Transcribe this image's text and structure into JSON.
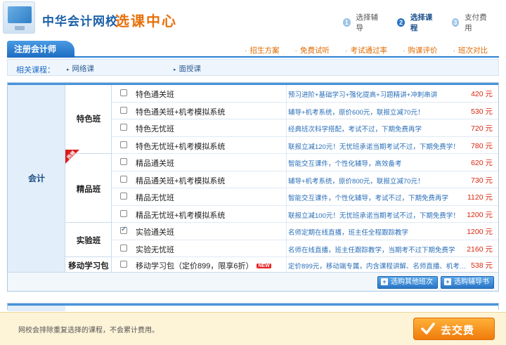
{
  "header": {
    "logo_title": "中华会计网校",
    "logo_subtitle": "选课中心",
    "steps": [
      {
        "num": "1",
        "label": "选择辅导"
      },
      {
        "num": "2",
        "label": "选择课程"
      },
      {
        "num": "3",
        "label": "支付费用"
      }
    ]
  },
  "tabbar": {
    "active_tab": "注册会计师",
    "links": [
      "招生方案",
      "免费试听",
      "考试通过率",
      "购课评价",
      "班次对比"
    ]
  },
  "related": {
    "label": "相关课程：",
    "links": [
      "网络课",
      "面授课"
    ]
  },
  "category": "会计",
  "groups": [
    {
      "label": "特色班"
    },
    {
      "label": "精品班",
      "badge": "热销"
    },
    {
      "label": "实验班"
    },
    {
      "label": "移动学习包"
    }
  ],
  "rows": [
    {
      "name": "特色通关班",
      "desc": "预习进阶+基础学习+强化提高+习题精讲+冲刺串讲",
      "price": "420 元",
      "checked": false
    },
    {
      "name": "特色通关班+机考模拟系统",
      "desc": "辅导+机考系统，原价600元，联报立减70元！",
      "price": "530 元",
      "checked": false
    },
    {
      "name": "特色无忧班",
      "desc": "经典班次科学搭配，考试不过，下期免费再学",
      "price": "720 元",
      "checked": false
    },
    {
      "name": "特色无忧班+机考模拟系统",
      "desc": "联报立减120元！无忧班承诺当期考试不过，下期免费学！",
      "price": "780 元",
      "checked": false
    },
    {
      "name": "精品通关班",
      "desc": "智能交互课件，个性化辅导，高效备考",
      "price": "620 元",
      "checked": false
    },
    {
      "name": "精品通关班+机考模拟系统",
      "desc": "辅导+机考系统，原价800元，联报立减70元！",
      "price": "730 元",
      "checked": false
    },
    {
      "name": "精品无忧班",
      "desc": "智能交互课件，个性化辅导，考试不过，下期免费再学",
      "price": "1120 元",
      "checked": false
    },
    {
      "name": "精品无忧班+机考模拟系统",
      "desc": "联报立减100元！无忧班承诺当期考试不过，下期免费学！",
      "price": "1200 元",
      "checked": false
    },
    {
      "name": "实验通关班",
      "desc": "名师定期在线直播，班主任全程跟踪教学",
      "price": "1200 元",
      "checked": true
    },
    {
      "name": "实验无忧班",
      "desc": "名师在线直播，班主任跟踪教学，当期考不过下期免费学",
      "price": "2160 元",
      "checked": false
    },
    {
      "name": "移动学习包（定价899，限享6折）",
      "badge": "NEW",
      "desc": "定价899元，移动端专属，内含课程讲解、名师直播、机考…",
      "price": "538 元",
      "checked": false
    }
  ],
  "actions": {
    "buy_other": "选购其他班次",
    "buy_tutor": "选购辅导书"
  },
  "bottom": {
    "note": "网校会排除重复选择的课程，不会累计费用。",
    "pay_label": "去交费"
  },
  "colors": {
    "brand_blue": "#1d6cc2",
    "accent_orange": "#e06a00",
    "price_red": "#d9250d"
  }
}
